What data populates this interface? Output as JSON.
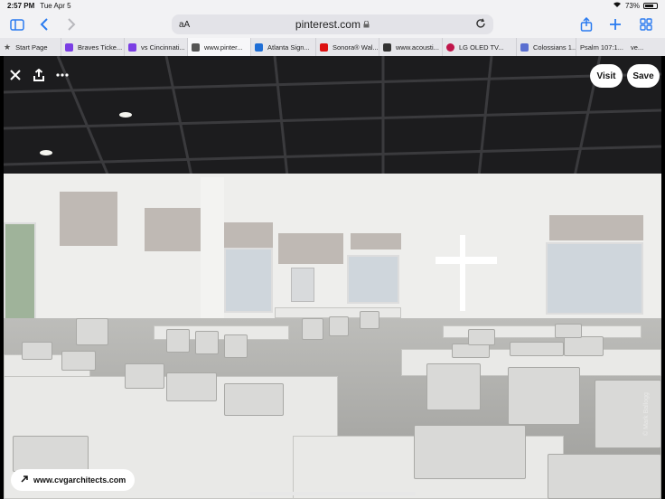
{
  "status_bar": {
    "time": "2:57 PM",
    "date": "Tue Apr 5",
    "battery_percent": "73%",
    "battery_level": 0.73
  },
  "toolbar": {
    "sidebar_icon": "sidebar-icon",
    "back_icon": "chevron-left-icon",
    "forward_icon": "chevron-right-icon",
    "share_icon": "share-icon",
    "new_tab_icon": "plus-icon",
    "tab_overview_icon": "grid-icon",
    "accent": "#2a7bf0"
  },
  "url_bar": {
    "reader_label": "aA",
    "host": "pinterest.com",
    "lock_icon": "lock-icon",
    "reload_icon": "reload-icon"
  },
  "tabs": [
    {
      "label": "Start Page",
      "icon": "star-icon"
    },
    {
      "label": "Braves Ticke...",
      "icon": "tab-favicon"
    },
    {
      "label": "vs Cincinnati...",
      "icon": "tab-favicon"
    },
    {
      "label": "www.pinter...",
      "icon": "tab-favicon",
      "active": true
    },
    {
      "label": "Atlanta Sign...",
      "icon": "tab-favicon"
    },
    {
      "label": "Sonora® Wal...",
      "icon": "tab-favicon"
    },
    {
      "label": "www.acousti...",
      "icon": "tab-favicon"
    },
    {
      "label": "LG OLED TV...",
      "icon": "tab-favicon"
    },
    {
      "label": "Colossians 1...",
      "icon": "tab-favicon"
    },
    {
      "label": "Psalm 107:1...",
      "icon": "tab-favicon"
    },
    {
      "label": "ve...",
      "icon": "tab-favicon"
    }
  ],
  "pin": {
    "close_icon": "close-icon",
    "share_icon": "share-icon",
    "more_icon": "more-icon",
    "visit_label": "Visit",
    "save_label": "Save",
    "source_label": "www.cvgarchitects.com",
    "source_icon": "link-icon",
    "watermark": "© Mark Ballogg"
  }
}
